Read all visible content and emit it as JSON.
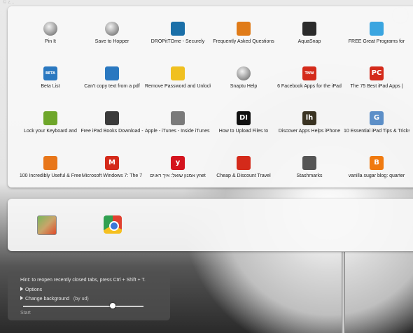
{
  "watermark": "© z...",
  "top_tiles": [
    {
      "label": "Pin It",
      "icon": "globe-icon"
    },
    {
      "label": "Save to Hopper",
      "icon": "globe-icon"
    },
    {
      "label": "DROPitTOme - Securely",
      "icon": "dropbox-icon",
      "color": "#1a6fa8"
    },
    {
      "label": "Frequently Asked Questions",
      "icon": "pencil-icon",
      "color": "#e07b18"
    },
    {
      "label": "AquaSnap",
      "icon": "aquasnap-icon",
      "color": "#2b2b2b"
    },
    {
      "label": "FREE Great Programs for",
      "icon": "pinwheel-icon",
      "color": "#3aa5e0"
    },
    {
      "label": "Beta List",
      "icon": "betalist-icon",
      "color": "#2a78c0",
      "text": "BETA LIST"
    },
    {
      "label": "Can't copy text from a pdf",
      "icon": "bracket-icon",
      "color": "#2a78c0"
    },
    {
      "label": "Remove Password and Unlock",
      "icon": "bulb-icon",
      "color": "#f0c020"
    },
    {
      "label": "Snaptu Help",
      "icon": "globe-icon"
    },
    {
      "label": "6 Facebook Apps for the iPad",
      "icon": "tnw-icon",
      "color": "#d42a1a",
      "text": "TNW"
    },
    {
      "label": "The 75 Best iPad Apps |",
      "icon": "pc-icon",
      "color": "#d42a1a",
      "text": "PC"
    },
    {
      "label": "Lock your Keyboard and",
      "icon": "leaf-icon",
      "color": "#6ea62a"
    },
    {
      "label": "Free iPad Books Download -",
      "icon": "books-icon",
      "color": "#3b3b3b"
    },
    {
      "label": "Apple - iTunes - Inside iTunes -",
      "icon": "apple-icon",
      "color": "#7a7a7a"
    },
    {
      "label": "How to Upload Files to",
      "icon": "di-icon",
      "color": "#111111",
      "text": "DI"
    },
    {
      "label": "Discover Apps Helps iPhone",
      "icon": "lh-icon",
      "color": "#3a3322",
      "text": "lh"
    },
    {
      "label": "10 Essential iPad Tips & Tricks",
      "icon": "g-icon",
      "color": "#5c8fc8",
      "text": "G"
    },
    {
      "label": "100 Incredibly Useful & Free",
      "icon": "lightning-icon",
      "color": "#e8761a"
    },
    {
      "label": "Microsoft Windows 7: The 7",
      "icon": "gmail-icon",
      "color": "#d42a1a",
      "text": "M"
    },
    {
      "label": "אמנון שואל: איך ראוים ynet",
      "icon": "ynet-icon",
      "color": "#d4141e",
      "text": "y"
    },
    {
      "label": "Cheap & Discount Travel",
      "icon": "travel-icon",
      "color": "#d42a1a"
    },
    {
      "label": "Stashmarks",
      "icon": "bookmark-icon",
      "color": "#555555"
    },
    {
      "label": "vanilla sugar blog: quarter",
      "icon": "blogger-icon",
      "color": "#f07a10",
      "text": "B"
    }
  ],
  "bottom_tiles": [
    {
      "icon": "maps-app-icon"
    },
    {
      "icon": "chrome-webstore-icon"
    }
  ],
  "hint": {
    "text": "Hint: to reopen recently closed tabs, press Ctrl + Shift + T.",
    "options": "Options",
    "change_bg": "Change background",
    "by": "(by ud)",
    "slider_value": 0.75,
    "start": "Start"
  }
}
